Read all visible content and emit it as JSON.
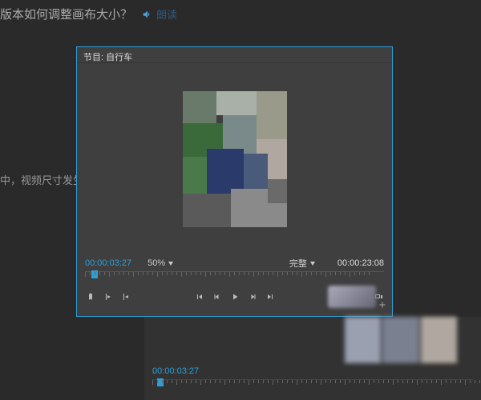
{
  "page": {
    "title": "版本如何调整画布大小？",
    "sound_label": "朗读"
  },
  "left_snippet": "中，视频尺寸发生",
  "monitor": {
    "header": "节目: 自行车",
    "timecode_current": "00:00:03:27",
    "zoom_value": "50%",
    "quality_label": "完整",
    "timecode_total": "00:00:23:08"
  },
  "lower": {
    "timecode": "00:00:03:27"
  },
  "icons": {
    "sound": "sound-icon",
    "marker": "marker-icon",
    "inpoint": "inpoint-icon",
    "outpoint": "outpoint-icon",
    "goto_in": "goto-in-icon",
    "step_back": "step-back-icon",
    "play": "play-icon",
    "step_fwd": "step-forward-icon",
    "goto_out": "goto-out-icon",
    "lift": "lift-icon",
    "extract": "extract-icon",
    "export": "export-frame-icon",
    "plus": "plus-icon"
  }
}
